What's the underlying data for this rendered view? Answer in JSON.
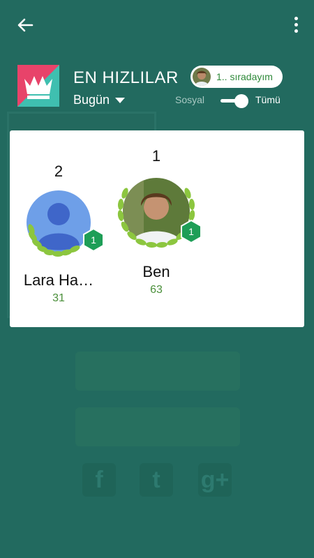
{
  "header": {
    "title": "EN HIZLILAR",
    "period": "Bugün",
    "rank_pill": "1.. sıradayım",
    "toggle_left": "Sosyal",
    "toggle_right": "Tümü"
  },
  "leaderboard": [
    {
      "rank": "2",
      "name": "Lara Ha…",
      "score": "31",
      "level": "1"
    },
    {
      "rank": "1",
      "name": "Ben",
      "score": "63",
      "level": "1"
    }
  ],
  "colors": {
    "background": "#226a5f",
    "card": "#ffffff",
    "score": "#4a8f3a",
    "badge": "#1e9e57",
    "laurel": "#8cc63f",
    "logo_pink": "#e8436a",
    "logo_teal": "#3fbfb0"
  },
  "icons": {
    "back": "arrow-left-icon",
    "menu": "more-vert-icon",
    "logo": "crown-icon",
    "period": "caret-down-icon"
  }
}
